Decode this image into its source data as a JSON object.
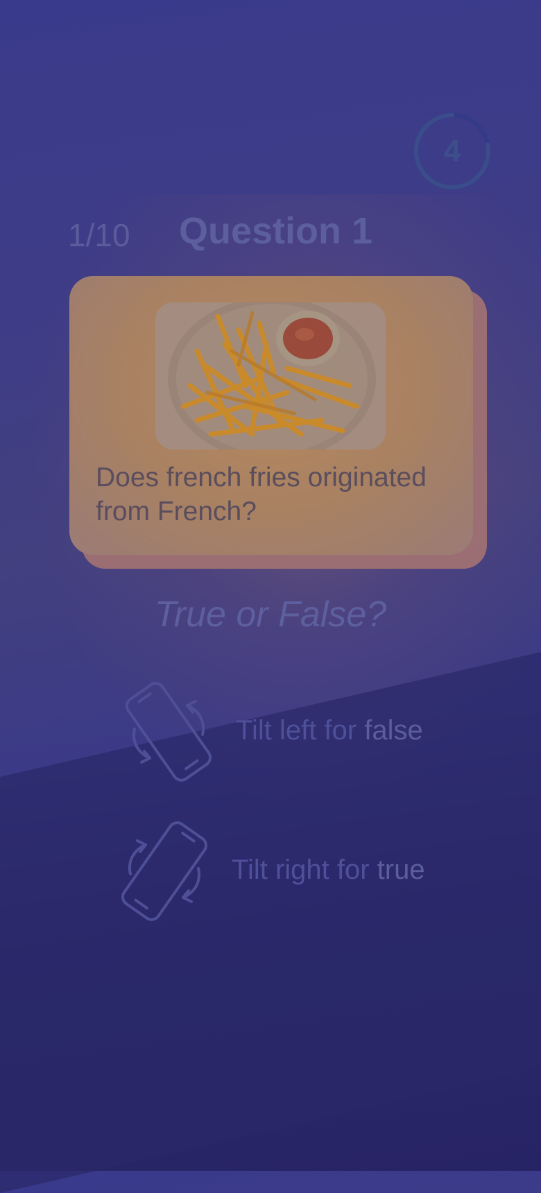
{
  "timer": {
    "seconds_left": "4",
    "ring_fraction": 0.78
  },
  "header": {
    "progress": "1/10",
    "title": "Question 1"
  },
  "card": {
    "question": "Does french fries originated from French?",
    "image": "french-fries-with-ketchup"
  },
  "prompt": "True or False?",
  "tilt_left": {
    "text": "Tilt left for ",
    "answer": "false"
  },
  "tilt_right": {
    "text": "Tilt right for ",
    "answer": "true"
  },
  "colors": {
    "accent": "#3a3a8c",
    "card": "#b7895d",
    "ring": "#3c4f8a"
  }
}
